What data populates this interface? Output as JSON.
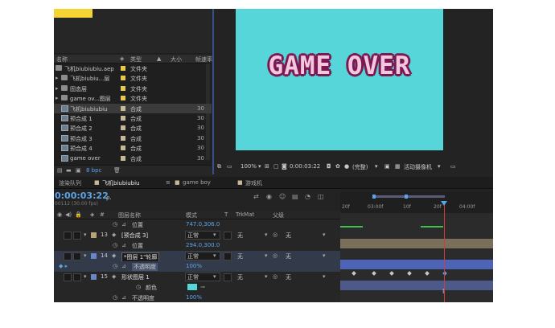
{
  "project": {
    "headers": {
      "name": "名称",
      "type": "类型",
      "size": "大小",
      "extra": "帧速率"
    },
    "items": [
      {
        "name": "飞机biubiubiu.aep",
        "type": "文件夹",
        "icon": "folder-icon",
        "color": "#e6c84a",
        "indent": 0,
        "open": true,
        "extra": "",
        "selected": false
      },
      {
        "name": "飞机biubiu...层",
        "type": "文件夹",
        "icon": "folder-icon",
        "color": "#e6c84a",
        "indent": 1,
        "open": false,
        "extra": "",
        "selected": false
      },
      {
        "name": "固态层",
        "type": "文件夹",
        "icon": "folder-icon",
        "color": "#e6c84a",
        "indent": 1,
        "open": false,
        "extra": "",
        "selected": false
      },
      {
        "name": "game ov...图层",
        "type": "文件夹",
        "icon": "folder-icon",
        "color": "#e6c84a",
        "indent": 1,
        "open": false,
        "extra": "",
        "selected": false
      },
      {
        "name": "飞机biubiubiu",
        "type": "合成",
        "icon": "composition-icon",
        "color": "#c8b89a",
        "indent": 1,
        "open": false,
        "extra": "30",
        "selected": true
      },
      {
        "name": "预合成 1",
        "type": "合成",
        "icon": "composition-icon",
        "color": "#c8b89a",
        "indent": 1,
        "open": false,
        "extra": "30",
        "selected": false
      },
      {
        "name": "预合成 2",
        "type": "合成",
        "icon": "composition-icon",
        "color": "#c8b89a",
        "indent": 1,
        "open": false,
        "extra": "30",
        "selected": false
      },
      {
        "name": "预合成 3",
        "type": "合成",
        "icon": "composition-icon",
        "color": "#c8b89a",
        "indent": 1,
        "open": false,
        "extra": "30",
        "selected": false
      },
      {
        "name": "预合成 4",
        "type": "合成",
        "icon": "composition-icon",
        "color": "#c8b89a",
        "indent": 1,
        "open": false,
        "extra": "30",
        "selected": false
      },
      {
        "name": "game over",
        "type": "合成",
        "icon": "composition-icon",
        "color": "#c8b89a",
        "indent": 1,
        "open": false,
        "extra": "30",
        "selected": false
      }
    ],
    "footer": {
      "bpc": "8 bpc"
    }
  },
  "viewer": {
    "canvas_text": "GAME OVER",
    "canvas_bg": "#56d6d8",
    "zoom": "100%",
    "timecode": "0:00:03:22",
    "quality": "(完整)",
    "camera": "活动摄像机"
  },
  "timeline": {
    "tabs": [
      {
        "label": "渲染队列",
        "active": false
      },
      {
        "label": "飞机biubiubiu",
        "active": true
      },
      {
        "label": "game boy",
        "active": false
      },
      {
        "label": "游戏机",
        "active": false
      }
    ],
    "timecode": "0:00:03:22",
    "fps_label": "00112 (30.00 fps)",
    "search_placeholder": "ρ.",
    "columns": {
      "name": "图层名称",
      "mode": "模式",
      "t": "T",
      "trkmat": "TrkMat",
      "parent": "父级"
    },
    "ruler": [
      "20f",
      "03:00f",
      "10f",
      "20f",
      "04:00f"
    ],
    "rows": [
      {
        "kind": "prop",
        "label": "位置",
        "value": "747.0,306.0"
      },
      {
        "kind": "layer",
        "num": "13",
        "name": "[预合成 3]",
        "color": "#b8a27a",
        "mode": "正常",
        "trkmat": "无",
        "parent": "无",
        "selected": false
      },
      {
        "kind": "prop",
        "label": "位置",
        "value": "294.0,300.0"
      },
      {
        "kind": "layer",
        "num": "14",
        "name": "*图层 1\"轮廓",
        "color": "#6a86c8",
        "mode": "正常",
        "trkmat": "无",
        "parent": "无",
        "selected": true
      },
      {
        "kind": "prop",
        "label": "不透明度",
        "value": "100%",
        "selected": true
      },
      {
        "kind": "layer",
        "num": "15",
        "name": "形状图层 1",
        "color": "#6a86c8",
        "mode": "正常",
        "trkmat": "无",
        "parent": "无",
        "selected": false
      },
      {
        "kind": "color",
        "label": "颜色",
        "value": ""
      },
      {
        "kind": "prop",
        "label": "不透明度",
        "value": "100%"
      }
    ]
  },
  "colors": {
    "accent": "#5aa4e8",
    "playhead": "#d83a3a",
    "selection": "#3b3b3b"
  }
}
